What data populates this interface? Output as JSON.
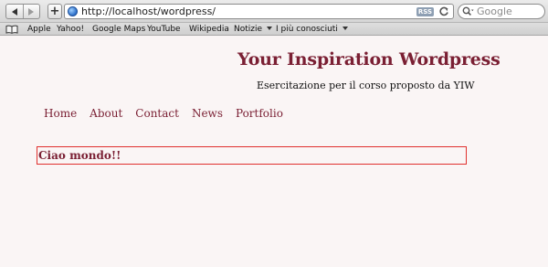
{
  "browser": {
    "address_url": "http://localhost/wordpress/",
    "rss_label": "RSS",
    "search_placeholder": "Google",
    "bookmarks": [
      {
        "label": "Apple",
        "has_menu": false
      },
      {
        "label": "Yahoo!",
        "has_menu": false
      },
      {
        "label": "Google Maps",
        "has_menu": false
      },
      {
        "label": "YouTube",
        "has_menu": false
      },
      {
        "label": "Wikipedia",
        "has_menu": false
      },
      {
        "label": "Notizie",
        "has_menu": true
      },
      {
        "label": "I più conosciuti",
        "has_menu": true
      }
    ],
    "icons": {
      "back": "back-arrow-icon",
      "forward": "forward-arrow-icon",
      "add": "plus-icon",
      "site": "globe-icon",
      "reload": "reload-icon",
      "search": "search-magnifier-icon",
      "bookmarks": "open-book-icon"
    }
  },
  "site": {
    "title": "Your Inspiration Wordpress",
    "description": "Esercitazione per il corso proposto da YIW",
    "menu": [
      "Home",
      "About",
      "Contact",
      "News",
      "Portfolio"
    ],
    "post_title": "Ciao mondo!!"
  },
  "colors": {
    "accent": "#7a1f33",
    "post_border": "#e0302e",
    "page_background": "#faf5f5"
  }
}
